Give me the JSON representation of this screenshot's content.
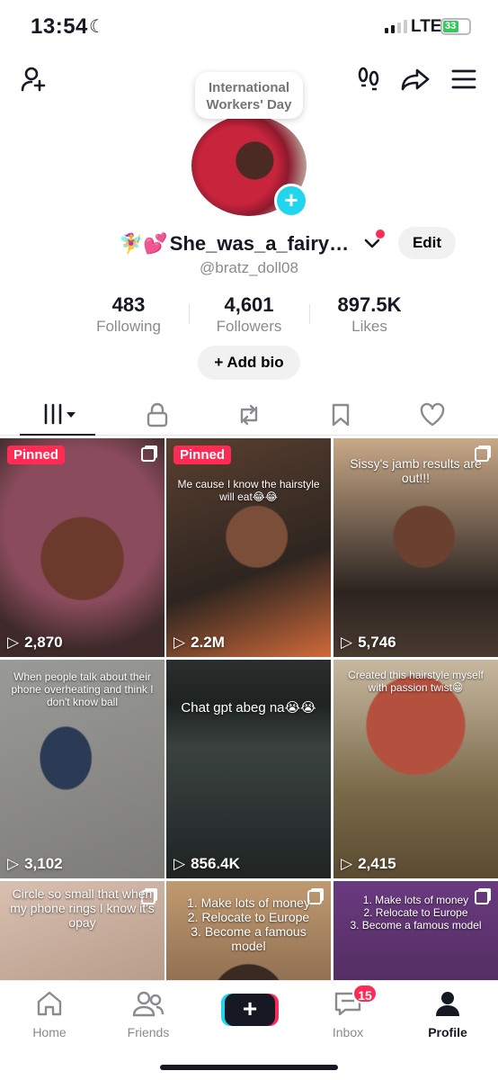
{
  "status_bar": {
    "time": "13:54",
    "network": "LTE",
    "battery": "33"
  },
  "header": {
    "bubble": "International Workers' Day"
  },
  "profile": {
    "display_name": "She_was_a_fairy…",
    "name_emoji": "🧚‍♀️💕",
    "handle": "@bratz_doll08",
    "edit_label": "Edit",
    "add_bio_label": "+ Add bio",
    "stats": [
      {
        "value": "483",
        "label": "Following"
      },
      {
        "value": "4,601",
        "label": "Followers"
      },
      {
        "value": "897.5K",
        "label": "Likes"
      }
    ]
  },
  "videos": [
    {
      "views": "2,870",
      "pinned": "Pinned",
      "caption": "",
      "multi": true
    },
    {
      "views": "2.2M",
      "pinned": "Pinned",
      "caption": "Me cause I know the hairstyle will eat😂😂",
      "multi": false
    },
    {
      "views": "5,746",
      "pinned": "",
      "caption": "Sissy's jamb results are out!!!",
      "multi": true
    },
    {
      "views": "3,102",
      "pinned": "",
      "caption": "When people talk about their phone overheating and think I don't know ball",
      "multi": false
    },
    {
      "views": "856.4K",
      "pinned": "",
      "caption": "Chat gpt abeg na😭😭",
      "multi": false
    },
    {
      "views": "2,415",
      "pinned": "",
      "caption": "Created this hairstyle myself with passion twist😁",
      "multi": false
    },
    {
      "views": "",
      "pinned": "",
      "caption": "Circle so small that when my phone rings I know it's opay",
      "multi": true
    },
    {
      "views": "",
      "pinned": "",
      "caption": "1. Make lots of money\n2. Relocate to Europe\n3. Become a famous model",
      "multi": true
    },
    {
      "views": "",
      "pinned": "",
      "caption": "1. Make lots of money\n2. Relocate to Europe\n3. Become a famous model",
      "multi": true
    }
  ],
  "bottom_nav": {
    "home": "Home",
    "friends": "Friends",
    "create": "+",
    "inbox": "Inbox",
    "inbox_badge": "15",
    "profile": "Profile"
  },
  "colors": {
    "accent": "#fe2c55",
    "cyan": "#20d5ec",
    "text": "#161823",
    "muted": "#8a8b91"
  }
}
